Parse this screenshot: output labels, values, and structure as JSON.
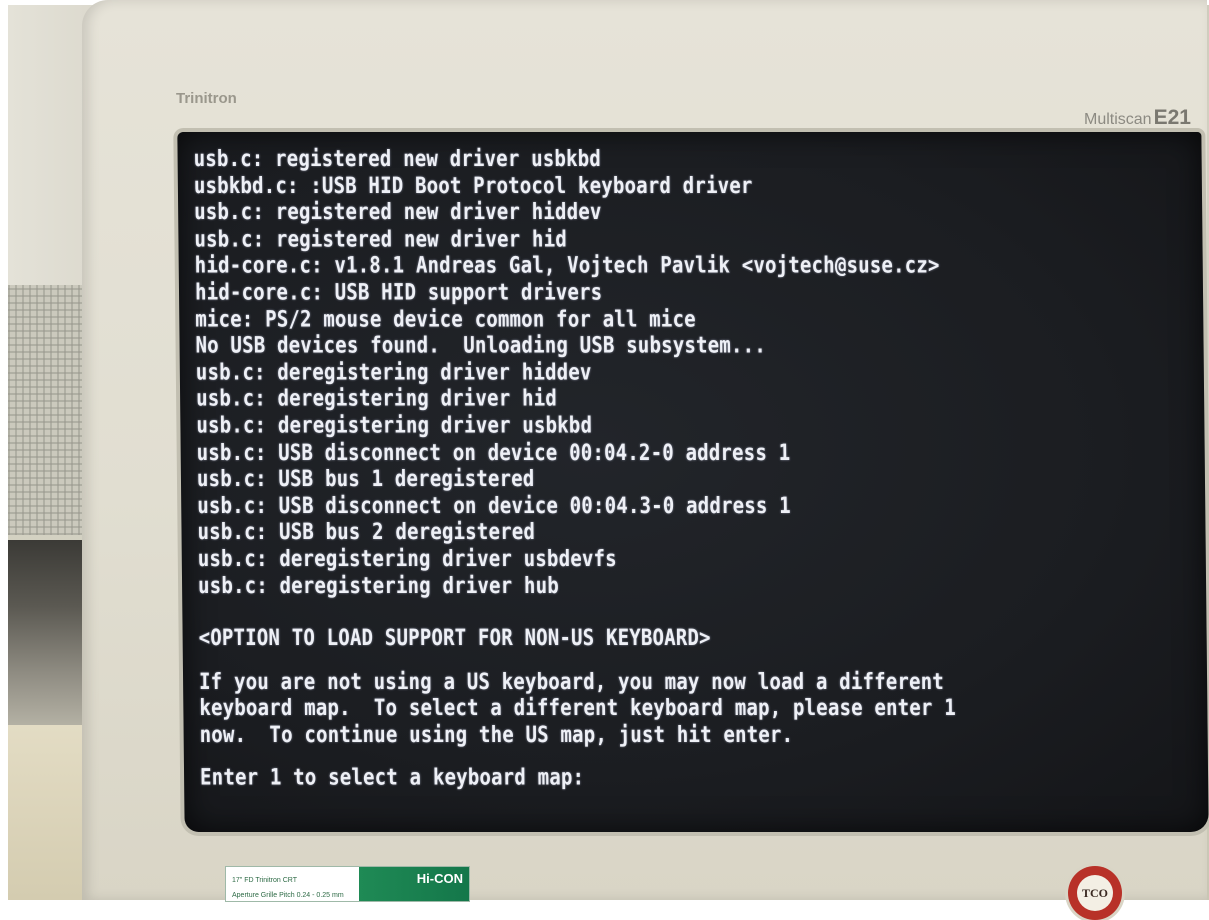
{
  "monitor": {
    "brand_left": "Trinitron",
    "brand_right": "Multiscan",
    "model": "E21",
    "sticker_brand": "Hi-CON",
    "sticker_line_1": "17\" FD Trinitron CRT",
    "sticker_line_2": "Aperture Grille Pitch 0.24 - 0.25 mm",
    "logo_text": "TCO"
  },
  "console": {
    "log_lines": [
      "usb.c: registered new driver usbkbd",
      "usbkbd.c: :USB HID Boot Protocol keyboard driver",
      "usb.c: registered new driver hiddev",
      "usb.c: registered new driver hid",
      "hid-core.c: v1.8.1 Andreas Gal, Vojtech Pavlik <vojtech@suse.cz>",
      "hid-core.c: USB HID support drivers",
      "mice: PS/2 mouse device common for all mice",
      "No USB devices found.  Unloading USB subsystem...",
      "usb.c: deregistering driver hiddev",
      "usb.c: deregistering driver hid",
      "usb.c: deregistering driver usbkbd",
      "usb.c: USB disconnect on device 00:04.2-0 address 1",
      "usb.c: USB bus 1 deregistered",
      "usb.c: USB disconnect on device 00:04.3-0 address 1",
      "usb.c: USB bus 2 deregistered",
      "usb.c: deregistering driver usbdevfs",
      "usb.c: deregistering driver hub"
    ],
    "option_heading": "<OPTION TO LOAD SUPPORT FOR NON-US KEYBOARD>",
    "message_lines": [
      "If you are not using a US keyboard, you may now load a different",
      "keyboard map.  To select a different keyboard map, please enter 1",
      "now.  To continue using the US map, just hit enter."
    ],
    "prompt": "Enter 1 to select a keyboard map:",
    "text_color": "#eef0f6",
    "background_color": "#1b1d21"
  }
}
